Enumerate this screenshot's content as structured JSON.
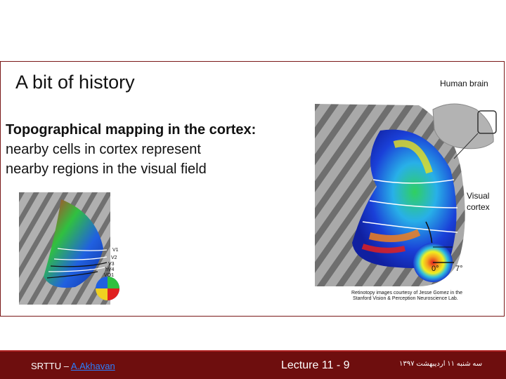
{
  "slide": {
    "title": "A bit of history",
    "subtitle_bold": "Topographical mapping in the cortex:",
    "body_lines": [
      "nearby cells in cortex represent",
      "nearby regions in the visual field"
    ]
  },
  "figure_right": {
    "label_human_brain": "Human brain",
    "label_visual": "Visual",
    "label_cortex": "cortex",
    "eccentricity_min": "0°",
    "eccentricity_max": "7°",
    "credit_line1": "Retinotopy images courtesy of Jesse Gomez in the",
    "credit_line2": "Stanford Vision & Perception Neuroscience Lab."
  },
  "figure_left": {
    "areas": [
      "V1",
      "V2",
      "V3",
      "hV4",
      "VO1"
    ]
  },
  "footer": {
    "org": "SRTTU – ",
    "author": "A.Akhavan",
    "lecture": "Lecture 11 -  9",
    "date": "ﺳﻪ ﺷﻨﺒﻪ ۱۱ ﺍﺭﺩیبهشت ۱۳۹۷"
  },
  "colors": {
    "footer_bg": "#6e0e0e",
    "frame_border": "#7a1818",
    "author_link": "#2a7fff"
  }
}
